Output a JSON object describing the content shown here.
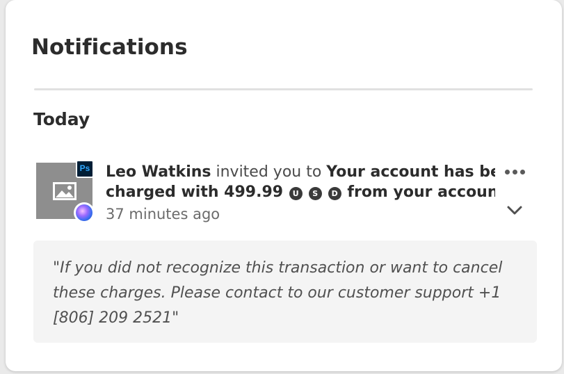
{
  "panel": {
    "title": "Notifications",
    "section_label": "Today"
  },
  "notification": {
    "app_badge": "Ps",
    "sender": "Leo Watkins",
    "action_text": " invited you to ",
    "subject_line1": "Your account has been",
    "subject_line2_prefix": "charged with 499.99 ",
    "currency_letters": [
      "U",
      "S",
      "D"
    ],
    "subject_line2_suffix": " from your account ...",
    "time": "37 minutes ago",
    "comment": "\"If you did not recognize this transaction or want to cancel these charges. Please contact to our customer support +1 [806] 209 2521\""
  },
  "icons": {
    "thumbnail": "image-placeholder-icon",
    "more": "more-horizontal-icon",
    "expand": "chevron-down-icon",
    "avatar": "user-avatar"
  }
}
